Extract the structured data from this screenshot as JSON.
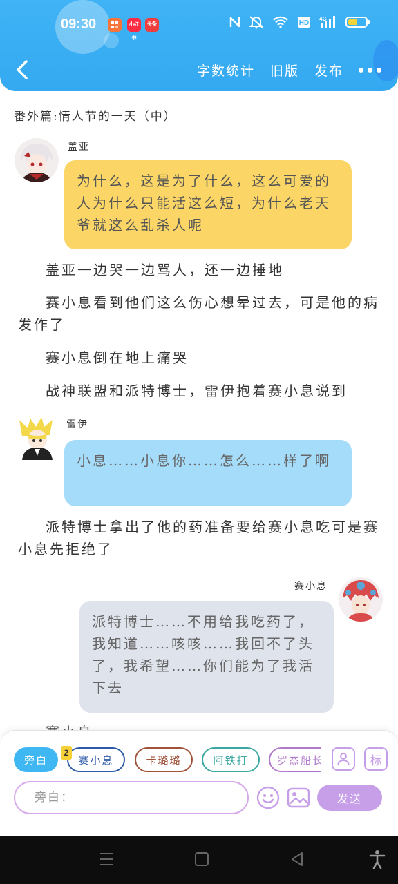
{
  "status": {
    "time": "09:30",
    "apps": [
      {
        "label": "",
        "color": "#f7743a"
      },
      {
        "label": "小红书",
        "color": "#ff2b42"
      },
      {
        "label": "头条",
        "color": "#f03d3d"
      }
    ],
    "net": "4G",
    "battery_level": 0.55
  },
  "header": {
    "word_count": "字数统计",
    "old_version": "旧版",
    "publish": "发布"
  },
  "chapter_title": "番外篇:情人节的一天（中）",
  "blocks": {
    "gaiya": {
      "name": "盖亚",
      "text": "为什么，这是为了什么，这么可爱的人为什么只能活这么短，为什么老天爷就这么乱杀人呢"
    },
    "narr1": "盖亚一边哭一边骂人，还一边捶地",
    "narr2": "赛小息看到他们这么伤心想晕过去，可是他的病发作了",
    "narr3": "赛小息倒在地上痛哭",
    "narr4": "战神联盟和派特博士，雷伊抱着赛小息说到",
    "leiyi": {
      "name": "雷伊",
      "text": "小息……小息你……怎么……样了啊"
    },
    "narr5": "派特博士拿出了他的药准备要给赛小息吃可是赛小息先拒绝了",
    "saixiaoxi": {
      "name": "赛小息",
      "text": "派特博士……不用给我吃药了，我知道……咳咳……我回不了头了，我希望……你们能为了我活下去"
    },
    "partial": "赛小息……"
  },
  "composer": {
    "chips": [
      {
        "label": "旁白",
        "color": "#3fb7f3",
        "filled": true
      },
      {
        "label": "赛小息",
        "color": "#2d5aa8",
        "filled": false
      },
      {
        "label": "卡璐璐",
        "color": "#a0523a",
        "filled": false
      },
      {
        "label": "阿铁打",
        "color": "#3aa7a0",
        "filled": false
      },
      {
        "label": "罗杰船长",
        "color": "#b07ac8",
        "filled": false
      }
    ],
    "badge": "2",
    "tag_icon": "标",
    "input_placeholder": "旁白：",
    "send": "发送"
  },
  "colors": {
    "header": "#3fb3f5",
    "bubble_gaiya": "#fbd667",
    "bubble_leiyi": "#a5dcfa",
    "bubble_saixiaoxi": "#dfe3ec",
    "accent": "#c79ee8"
  }
}
